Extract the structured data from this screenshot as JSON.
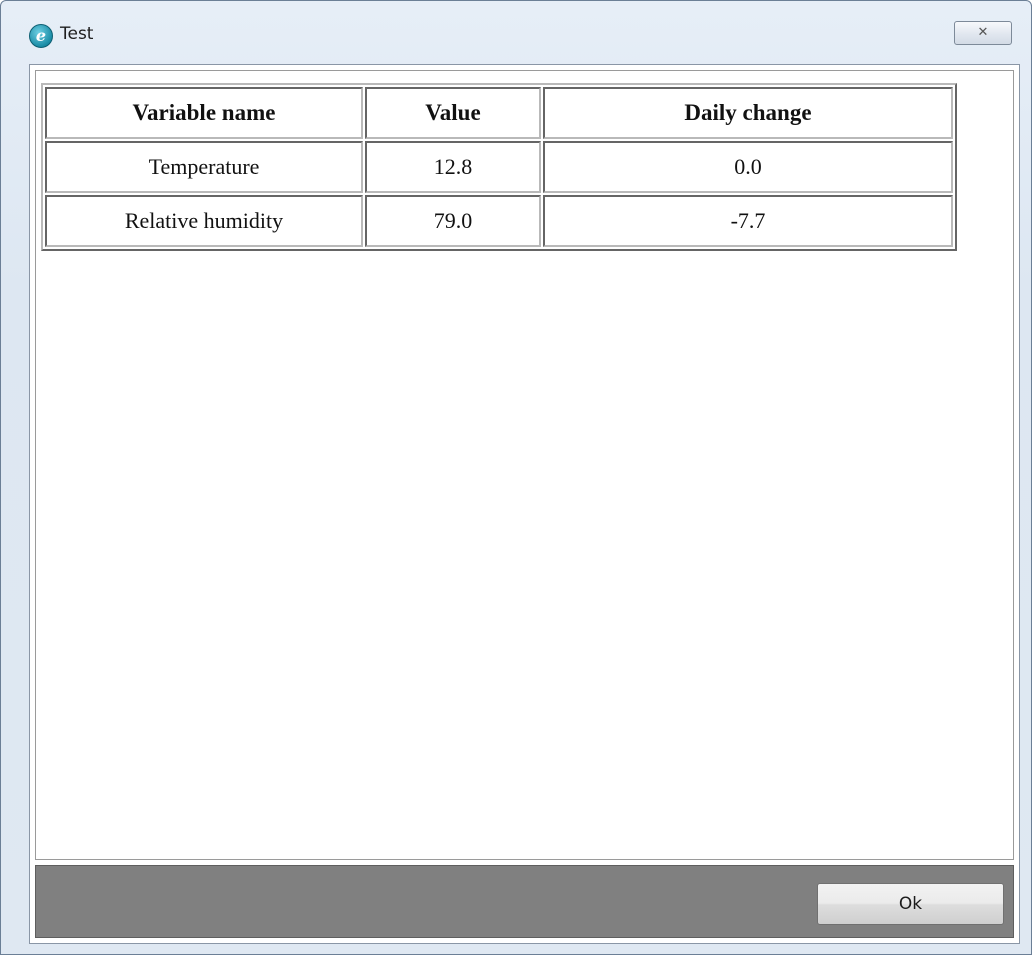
{
  "window": {
    "title": "Test",
    "icon": "app-e-icon",
    "close_glyph": "✕"
  },
  "table": {
    "headers": [
      "Variable name",
      "Value",
      "Daily change"
    ],
    "rows": [
      [
        "Temperature",
        "12.8",
        "0.0"
      ],
      [
        "Relative humidity",
        "79.0",
        "-7.7"
      ]
    ]
  },
  "footer": {
    "ok_label": "Ok"
  },
  "colors": {
    "footer_bg": "#808080",
    "titlebar_bg": "#dde7f2"
  }
}
